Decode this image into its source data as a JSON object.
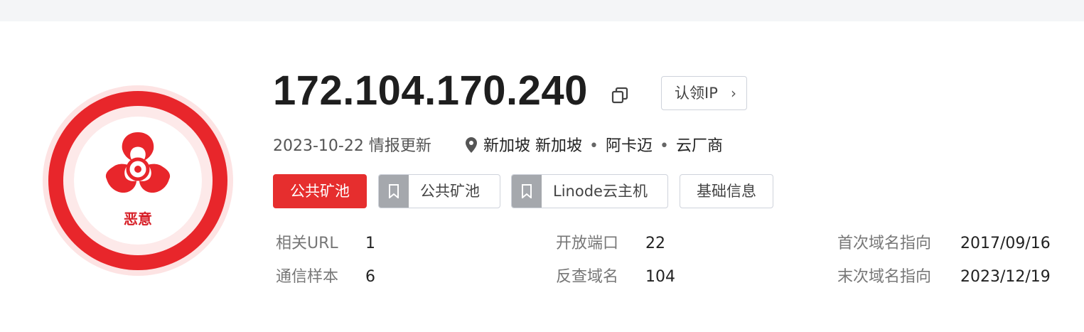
{
  "risk": {
    "level_label": "恶意",
    "color": "#e8262b"
  },
  "ip": {
    "address": "172.104.170.240",
    "claim_label": "认领IP"
  },
  "meta": {
    "updated": "2023-10-22 情报更新",
    "location": "新加坡 新加坡",
    "org": "阿卡迈",
    "category": "云厂商"
  },
  "tags": [
    {
      "label": "公共矿池",
      "style": "red"
    },
    {
      "label": "公共矿池",
      "style": "bookmark"
    },
    {
      "label": "Linode云主机",
      "style": "bookmark"
    },
    {
      "label": "基础信息",
      "style": "plain"
    }
  ],
  "stats": [
    {
      "key": "相关URL",
      "value": "1"
    },
    {
      "key": "开放端口",
      "value": "22"
    },
    {
      "key": "首次域名指向",
      "value": "2017/09/16"
    },
    {
      "key": "通信样本",
      "value": "6"
    },
    {
      "key": "反查域名",
      "value": "104"
    },
    {
      "key": "末次域名指向",
      "value": "2023/12/19"
    }
  ]
}
